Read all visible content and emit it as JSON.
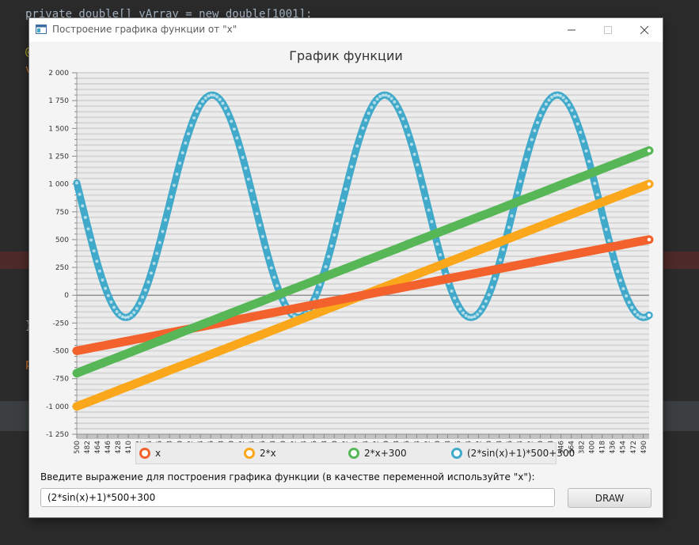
{
  "ide": {
    "code_line_top": "private double[] yArray = new double[1001];",
    "code_fragment_ann": "@",
    "code_fragment_v": "v",
    "code_fragment_brace": "}",
    "code_fragment_p": "p"
  },
  "window": {
    "title": "Построение графика функции от \"x\"",
    "icons": {
      "app": "app-window-icon",
      "minimize": "minimize-icon",
      "maximize": "maximize-icon",
      "close": "close-icon"
    }
  },
  "chart_data": {
    "type": "line",
    "title": "График функции",
    "xlabel": "",
    "ylabel": "",
    "x_range": [
      -500,
      500
    ],
    "ylim": [
      -1250,
      2000
    ],
    "y_ticks": [
      -1250,
      -1000,
      -750,
      -500,
      -250,
      0,
      250,
      500,
      750,
      1000,
      1250,
      1500,
      1750,
      2000
    ],
    "y_tick_labels": [
      "-1 250",
      "-1 000",
      "-750",
      "-500",
      "-250",
      "0",
      "250",
      "500",
      "750",
      "1 000",
      "1 250",
      "1 500",
      "1 750",
      "2 000"
    ],
    "x_tick_labels": [
      "-500",
      "-482",
      "-464",
      "-446",
      "-428",
      "-410",
      "-392",
      "-374",
      "-356",
      "-338",
      "-320",
      "-302",
      "-284",
      "-266",
      "-248",
      "-230",
      "-212",
      "-194",
      "-176",
      "-158",
      "-140",
      "-122",
      "-104",
      "-86",
      "-68",
      "-50",
      "-32",
      "-14",
      "4",
      "22",
      "40",
      "58",
      "76",
      "94",
      "112",
      "130",
      "148",
      "166",
      "184",
      "202",
      "220",
      "238",
      "256",
      "274",
      "292",
      "310",
      "328",
      "346",
      "364",
      "382",
      "400",
      "418",
      "436",
      "454",
      "472",
      "490"
    ],
    "grid": true,
    "legend_position": "bottom",
    "series": [
      {
        "name": "x",
        "color": "#f3622d",
        "y_start": -500,
        "y_end": 500,
        "formula": "x"
      },
      {
        "name": "2*x",
        "color": "#fba71b",
        "y_start": -1000,
        "y_end": 1000,
        "formula": "2*x"
      },
      {
        "name": "2*x+300",
        "color": "#57b757",
        "y_start": -700,
        "y_end": 1300,
        "formula": "2*x+300"
      },
      {
        "name": "(2*sin(x)+1)*500+300",
        "color": "#41a9c9",
        "min": -200,
        "max": 1800,
        "formula": "(2*sin(x)+1)*500+300"
      }
    ]
  },
  "form": {
    "prompt": "Введите выражение для построения графика функции (в качестве переменной используйте \"x\"):",
    "expression_value": "(2*sin(x)+1)*500+300",
    "draw_label": "DRAW"
  }
}
